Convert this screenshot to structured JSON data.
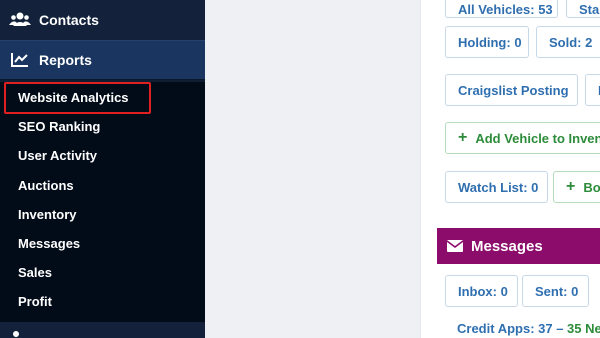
{
  "sidebar": {
    "contacts_label": "Contacts",
    "reports_label": "Reports",
    "submenu": [
      "Website Analytics",
      "SEO Ranking",
      "User Activity",
      "Auctions",
      "Inventory",
      "Messages",
      "Sales",
      "Profit"
    ]
  },
  "panel": {
    "all_vehicles": "All Vehicles: 53",
    "status_partial": "Sta",
    "holding": "Holding: 0",
    "sold": "Sold: 2",
    "craigslist": "Craigslist Posting",
    "craigslist_next": "F",
    "add_vehicle": "Add Vehicle to Inven",
    "watch_list": "Watch List: 0",
    "bo_partial": "Bo",
    "messages_title": "Messages",
    "inbox": "Inbox: 0",
    "sent": "Sent: 0",
    "credit_apps": "Credit Apps: 37 – ",
    "credit_new": "35 Ne"
  },
  "colors": {
    "sidebar_bg": "#0f1e33",
    "reports_bg": "#193560",
    "highlight": "#e02020",
    "messages_bg": "#8c0c6c",
    "link_blue": "#2f6fb0",
    "green": "#2d8c3a"
  }
}
